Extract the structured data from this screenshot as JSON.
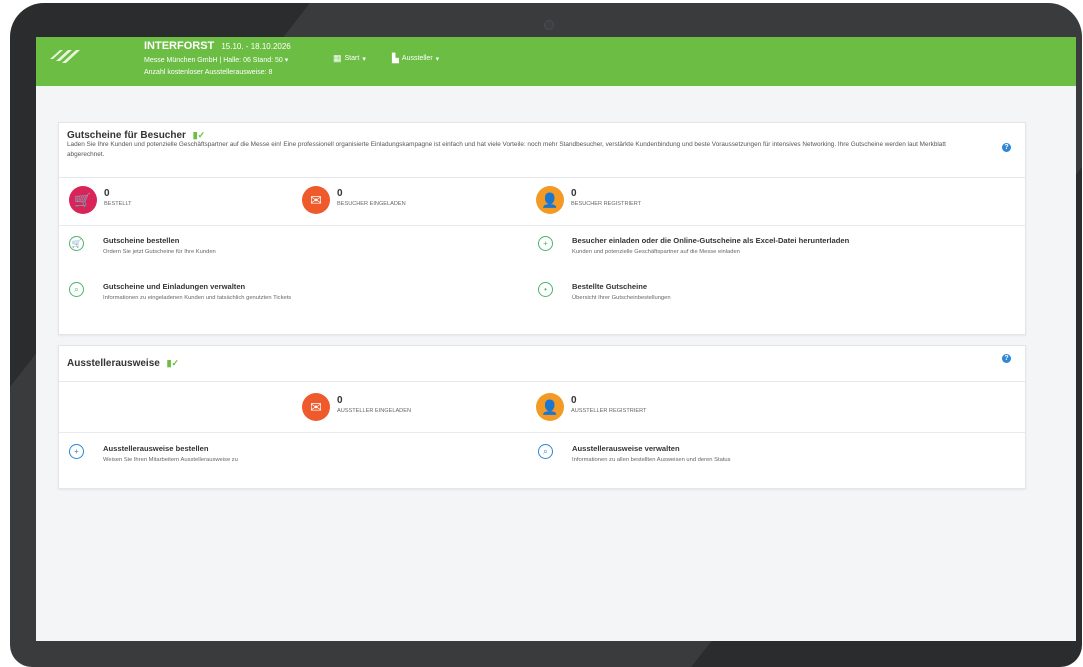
{
  "colors": {
    "brand_green": "#6cbd44",
    "bestellt": "#d9245a",
    "eingeladen": "#ee5a2c",
    "registriert": "#f29a24",
    "help_blue": "#2d87d3"
  },
  "header": {
    "title": "INTERFORST",
    "dates": "15.10. - 18.10.2026",
    "exhibitor_info": "Messe München GmbH | Halle: 06 Stand: 50",
    "free_passes": "Anzahl kostenloser Ausstellerausweise: 8",
    "menu": [
      {
        "label": "Start",
        "icon": "grid-icon"
      },
      {
        "label": "Aussteller",
        "icon": "building-icon"
      }
    ]
  },
  "vouchers": {
    "title": "Gutscheine für Besucher",
    "description": "Laden Sie Ihre Kunden und potenzielle Geschäftspartner auf die Messe ein! Eine professionell organisierte Einladungskampagne ist einfach und hat viele Vorteile: noch mehr Standbesucher, verstärkte Kundenbindung und beste Voraussetzungen für intensives Networking. Ihre Gutscheine werden laut Merkblatt abgerechnet.",
    "stats": [
      {
        "value": "0",
        "label": "BESTELLT",
        "icon": "cart-icon"
      },
      {
        "value": "0",
        "label": "BESUCHER EINGELADEN",
        "icon": "envelope-icon"
      },
      {
        "value": "0",
        "label": "BESUCHER REGISTRIERT",
        "icon": "user-add-icon"
      }
    ],
    "links": [
      {
        "title": "Gutscheine bestellen",
        "subtitle": "Ordern Sie jetzt Gutscheine für Ihre Kunden",
        "icon": "cart-icon"
      },
      {
        "title": "Besucher einladen oder die Online-Gutscheine als Excel-Datei herunterladen",
        "subtitle": "Kunden und potenzielle Geschäftspartner auf die Messe einladen",
        "icon": "user-add-icon"
      },
      {
        "title": "Gutscheine und Einladungen verwalten",
        "subtitle": "Informationen zu eingeladenen Kunden und tatsächlich genutzten Tickets",
        "icon": "search-icon"
      },
      {
        "title": "Bestellte Gutscheine",
        "subtitle": "Übersicht Ihrer Gutscheinbestellungen",
        "icon": "user-icon"
      }
    ]
  },
  "passes": {
    "title": "Ausstellerausweise",
    "stats": [
      {
        "value": "0",
        "label": "AUSSTELLER EINGELADEN",
        "icon": "envelope-icon"
      },
      {
        "value": "0",
        "label": "AUSSTELLER REGISTRIERT",
        "icon": "user-add-icon"
      }
    ],
    "links": [
      {
        "title": "Ausstellerausweise bestellen",
        "subtitle": "Weisen Sie Ihren Mitarbeitern Ausstellerausweise zu",
        "icon": "user-add-icon"
      },
      {
        "title": "Ausstellerausweise verwalten",
        "subtitle": "Informationen zu allen bestellten Ausweisen und deren Status",
        "icon": "search-icon"
      }
    ]
  }
}
